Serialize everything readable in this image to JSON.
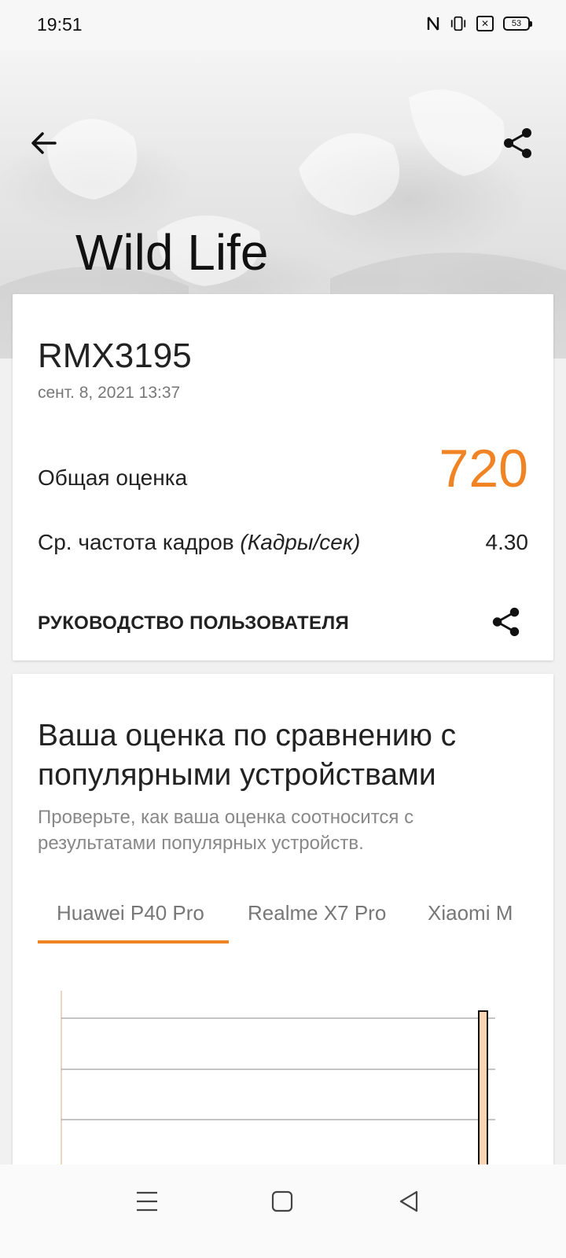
{
  "status_bar": {
    "time": "19:51",
    "icons": [
      "nfc-icon",
      "vibrate-icon",
      "sim-off-icon",
      "battery-icon"
    ],
    "battery": "53"
  },
  "header": {
    "title": "Wild Life",
    "back_icon": "arrow-left-icon",
    "share_icon": "share-icon"
  },
  "result": {
    "device": "RMX3195",
    "date": "сент. 8, 2021 13:37",
    "overall_label": "Общая оценка",
    "overall_value": "720",
    "fps_label": "Ср. частота кадров ",
    "fps_unit": "(Кадры/сек)",
    "fps_value": "4.30",
    "guide_label": "РУКОВОДСТВО ПОЛЬЗОВАТЕЛЯ",
    "accent_color": "#f08424"
  },
  "compare": {
    "title": "Ваша оценка по сравнению с популярными устройствами",
    "subtitle": "Проверьте, как ваша оценка соотносится с результатами популярных устройств.",
    "tabs": [
      "Huawei P40 Pro",
      "Realme X7 Pro",
      "Xiaomi M"
    ],
    "selected_tab": 0
  },
  "chart_data": {
    "type": "bar",
    "title": "",
    "xlabel": "",
    "ylabel": "",
    "grid": true,
    "bar_color": "#fbd4b4",
    "bar_outline": "#111111",
    "series": [
      {
        "values": [
          1
        ]
      }
    ],
    "note_visible": "chart partially visible; no tick labels shown"
  },
  "nav_bar": {
    "icons": [
      "menu-icon",
      "home-icon",
      "back-triangle-icon"
    ]
  }
}
